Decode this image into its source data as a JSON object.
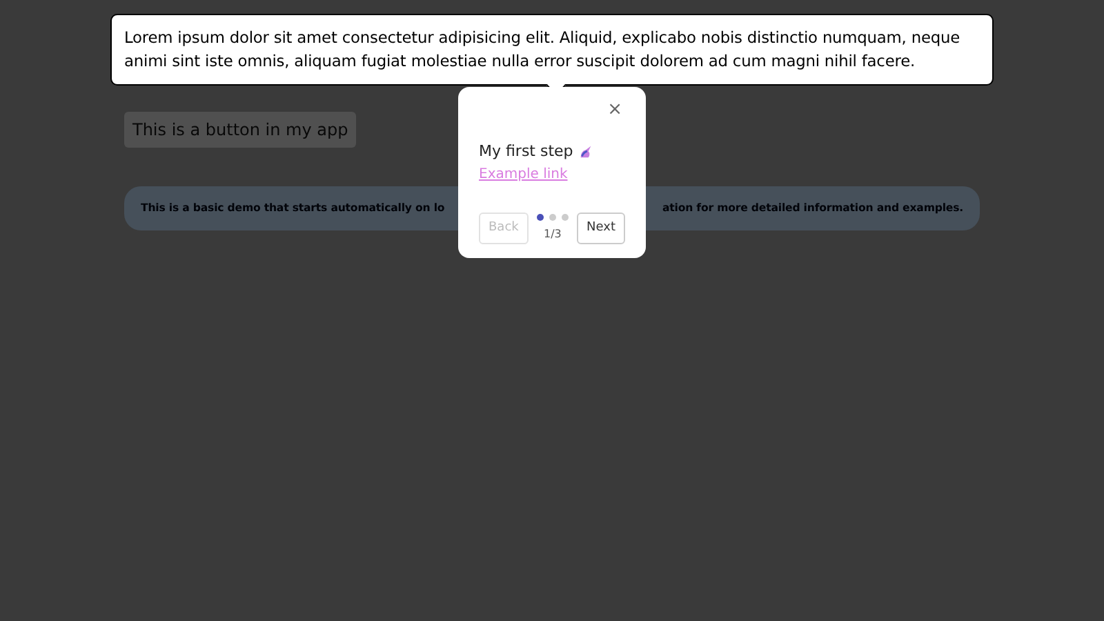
{
  "tooltip": {
    "text": "Lorem ipsum dolor sit amet consectetur adipisicing elit. Aliquid, explicabo nobis distinctio numquam, neque animi sint iste omnis, aliquam fugiat molestiae nulla error suscipit dolorem ad cum magni nihil facere."
  },
  "app_button": {
    "label": "This is a button in my app"
  },
  "alert": {
    "text_start": "This is a basic demo that starts automatically on lo",
    "text_end": "ation for more detailed information and examples."
  },
  "tour_step": {
    "close": "×",
    "title": "My first step",
    "link": "Example link",
    "back": {
      "label": "Back",
      "disabled": true
    },
    "next": {
      "label": "Next",
      "disabled": false
    },
    "progress": "1/3",
    "dots": [
      {
        "selected": true
      },
      {
        "selected": false
      },
      {
        "selected": false
      }
    ]
  }
}
